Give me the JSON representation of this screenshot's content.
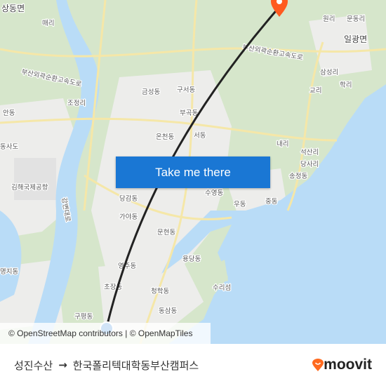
{
  "map": {
    "labels": {
      "sangdong": "상동면",
      "maeri": "매리",
      "outer_ring": "부산외곽순환고속도로",
      "outer_ring2": "부산외곽순환고속도로",
      "andong": "안동",
      "jojeong": "조정리",
      "geumseong": "금성동",
      "guseo": "구서동",
      "bugok": "부곡동",
      "oncheon": "온천동",
      "seodong": "서동",
      "airport": "김해국제공항",
      "dangam": "당감동",
      "gaya": "가야동",
      "munhyeon": "문현동",
      "suyeong": "수영동",
      "udong": "우동",
      "jungdong": "중동",
      "yongdang": "용당동",
      "yeonsu": "영주동",
      "chojang": "초장동",
      "cheonghak": "청학동",
      "dongsam": "동삼동",
      "gupyeong": "구평동",
      "myeongji": "명지동",
      "gangbyeon": "강변대로",
      "suriseom": "수리섬",
      "ilgwang": "일광면",
      "wonri": "원리",
      "mundong": "문동리",
      "samseong": "삼성리",
      "gyori": "교리",
      "hakri": "학리",
      "naeri": "내리",
      "seoksan": "석산리",
      "dangsa": "당사리",
      "songjeong": "송정동",
      "sasang": "동사도"
    },
    "colors": {
      "land": "#d9e8cf",
      "urban": "#ececec",
      "water": "#b9dcf7",
      "route": "#222222",
      "origin": "#1a77d4",
      "destination": "#ff5a1f"
    }
  },
  "cta": {
    "label": "Take me there"
  },
  "attribution": "© OpenStreetMap contributors | © OpenMapTiles",
  "footer": {
    "origin": "성진수산",
    "arrow": "→",
    "destination": "한국폴리텍대학동부산캠퍼스",
    "brand": "moovit",
    "brand_color": "#ff6a1f"
  }
}
